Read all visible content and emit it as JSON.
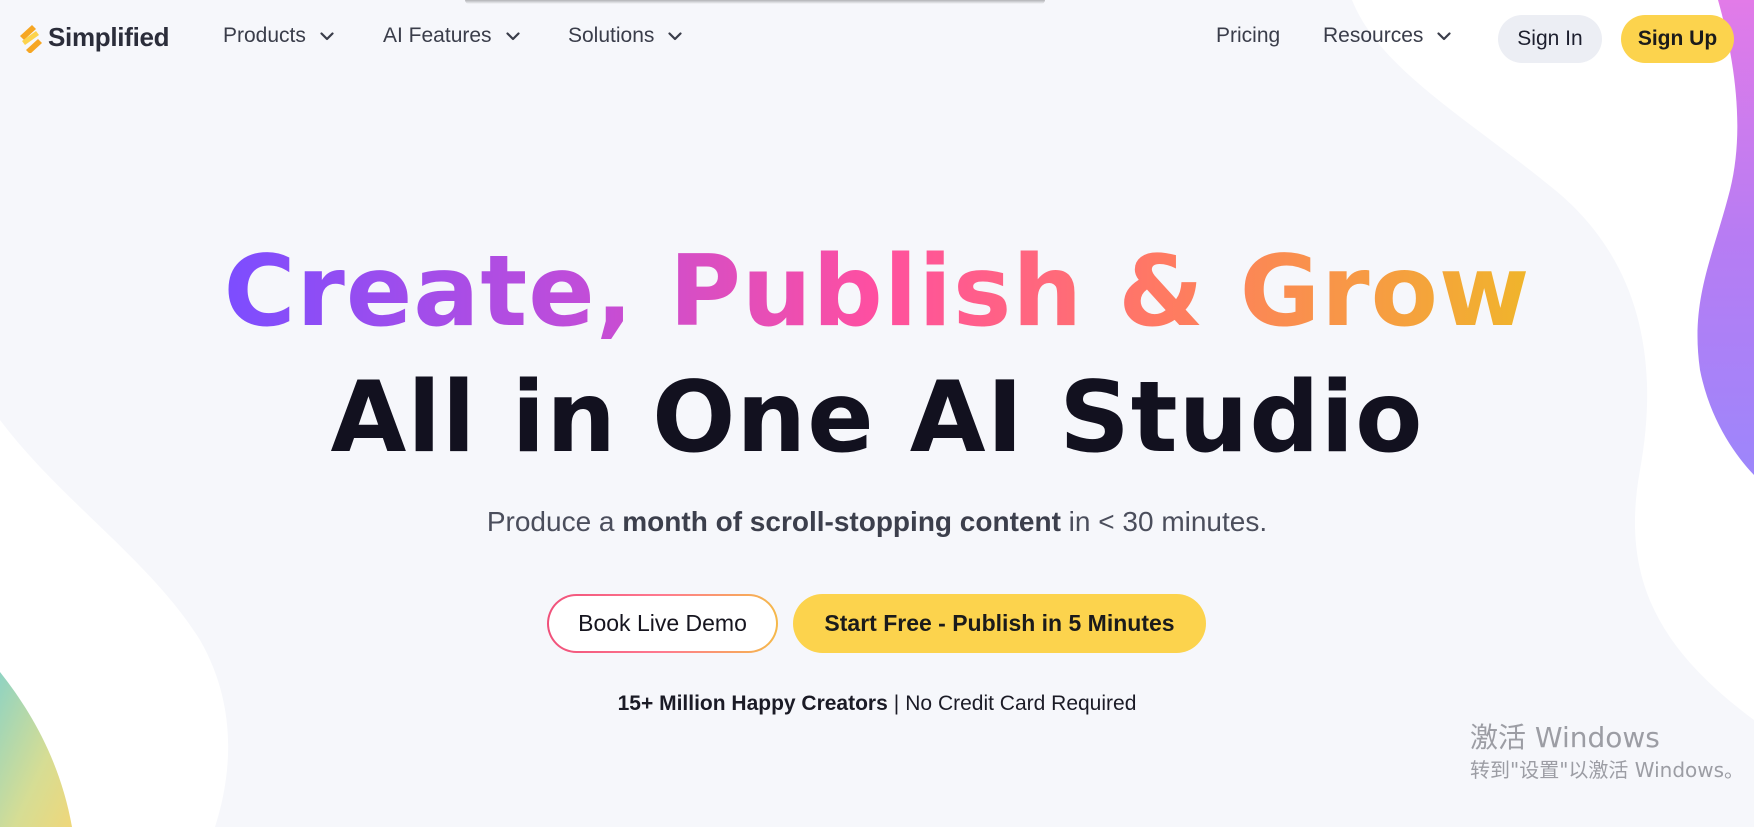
{
  "brand": {
    "name": "Simplified",
    "mark_colors": [
      "#f6a623",
      "#fcd34d"
    ]
  },
  "nav": {
    "products": "Products",
    "ai_features": "AI Features",
    "solutions": "Solutions",
    "pricing": "Pricing",
    "resources": "Resources",
    "sign_in": "Sign In",
    "sign_up": "Sign Up"
  },
  "hero": {
    "headline_1": "Create, Publish & Grow",
    "headline_2": "All in One AI Studio",
    "subtitle_pre": "Produce a ",
    "subtitle_bold": "month of scroll-stopping content",
    "subtitle_post": " in < 30 minutes.",
    "cta_demo": "Book Live Demo",
    "cta_start": "Start Free - Publish in 5 Minutes",
    "proof_bold": "15+ Million Happy Creators",
    "proof_sep": "|",
    "proof_rest": "No Credit Card Required"
  },
  "watermark": {
    "title": "激活 Windows",
    "subtitle": "转到\"设置\"以激活 Windows。"
  },
  "colors": {
    "accent_yellow": "#fcd34d",
    "headline_gradient": [
      "#7c4dff",
      "#c24dd8",
      "#ff4fa0",
      "#ff7a62",
      "#f0b52b"
    ],
    "page_background": "#f6f7fb",
    "headline_dark": "#12111f"
  }
}
